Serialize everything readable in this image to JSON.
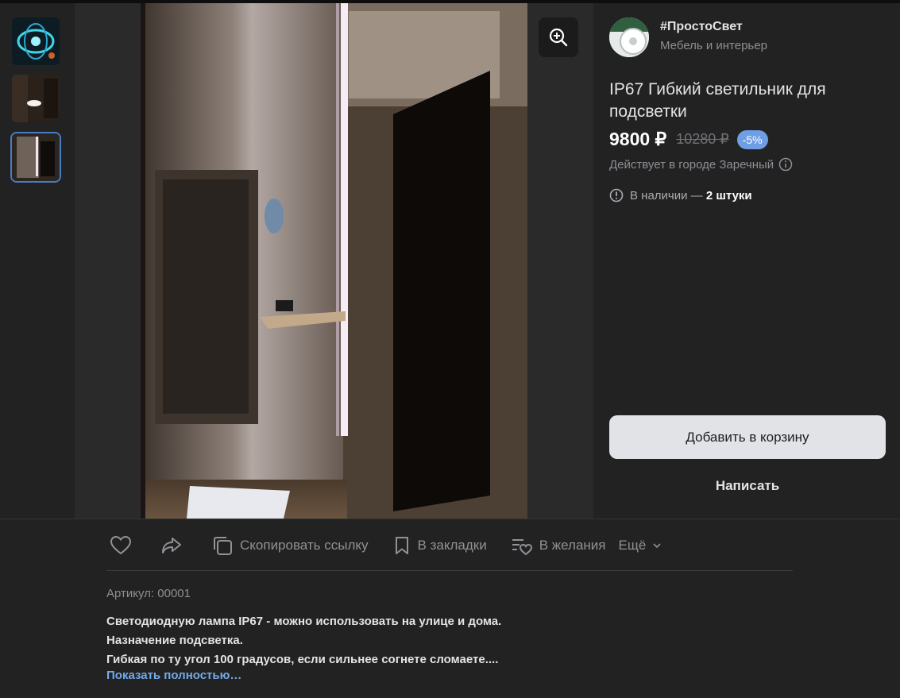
{
  "shop": {
    "name": "#ПростоСвет",
    "category": "Мебель и интерьер"
  },
  "product": {
    "title": "IP67 Гибкий светильник для подсветки",
    "price": "9800 ₽",
    "old_price": "10280 ₽",
    "discount": "-5%",
    "city_note": "Действует в городе Заречный",
    "stock_prefix": "В наличии — ",
    "stock_count": "2 штуки",
    "sku": "Артикул: 00001",
    "description": [
      "Светодиодную лампа IP67 - можно использовать на улице и дома.",
      "Назначение подсветка.",
      "Гибкая по ту угол 100 градусов, если сильнее согнете сломаете...."
    ],
    "show_more": "Показать полностью…"
  },
  "buttons": {
    "add_to_cart": "Добавить в корзину",
    "write": "Написать"
  },
  "actions": {
    "copy_link": "Скопировать ссылку",
    "bookmarks": "В закладки",
    "wishlist": "В желания",
    "more": "Ещё"
  },
  "icons": {
    "zoom": "zoom-in-icon",
    "like": "heart-icon",
    "share": "share-icon",
    "copy": "copy-icon",
    "bookmark": "bookmark-icon",
    "wishlist": "wishlist-icon",
    "info": "info-icon",
    "stock": "alert-circle-icon"
  },
  "colors": {
    "accent_link": "#71aaeb",
    "discount_badge": "#6f9ee5",
    "panel_bg": "#222222"
  }
}
